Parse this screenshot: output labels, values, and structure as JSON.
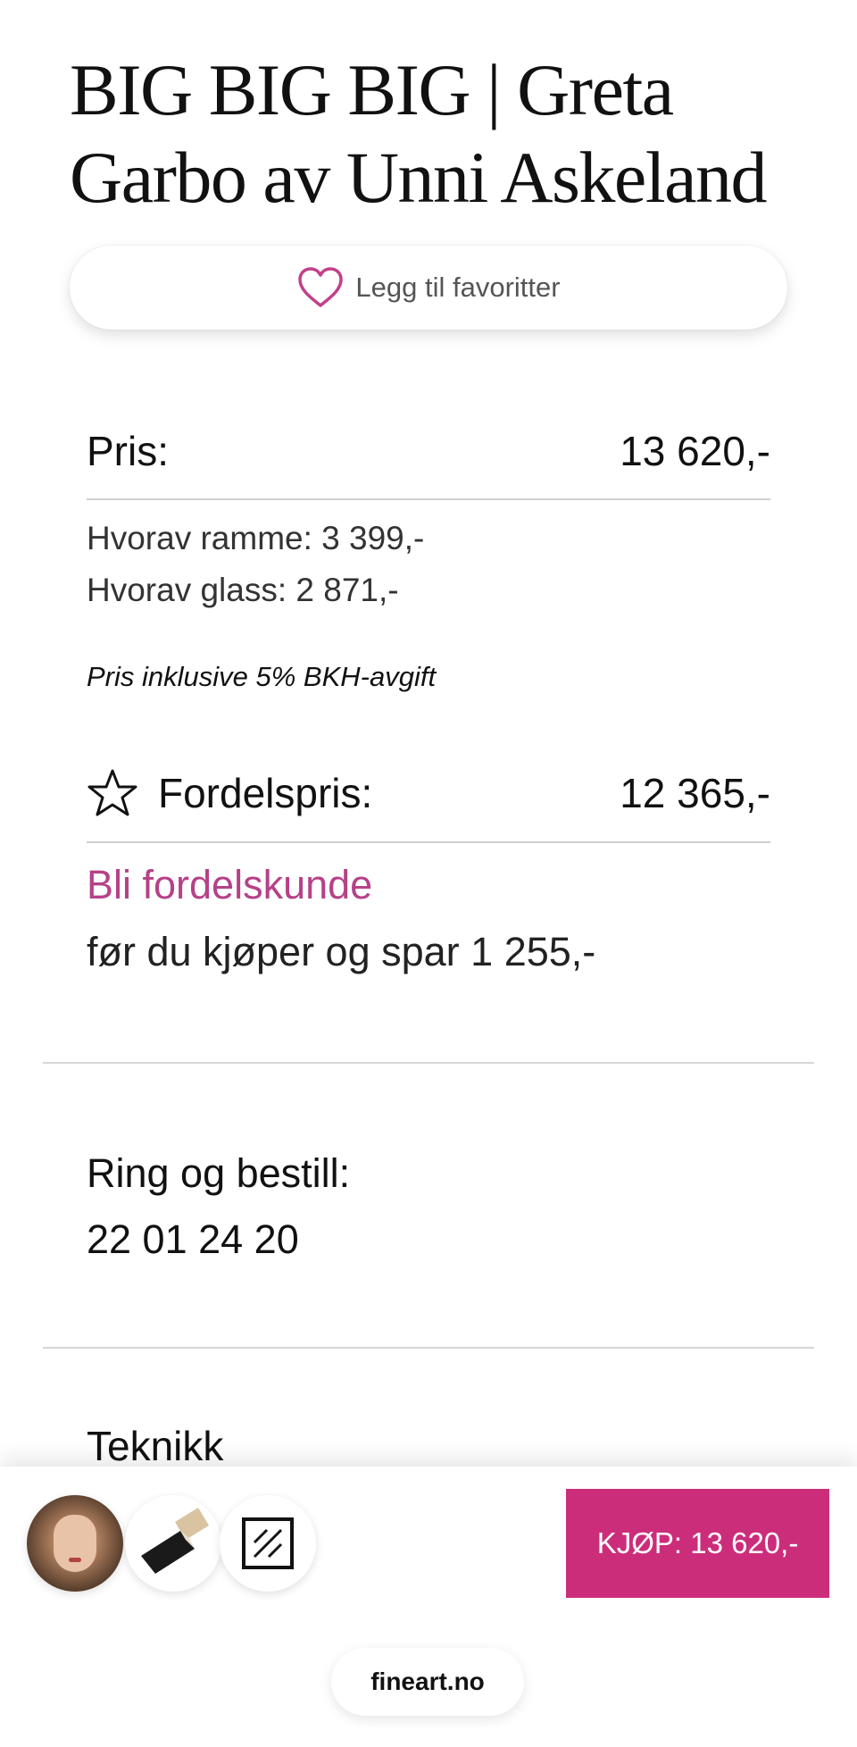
{
  "product": {
    "title": "BIG BIG BIG | Greta Garbo av Unni Askeland"
  },
  "favorite": {
    "label": "Legg til favoritter",
    "icon": "heart-icon"
  },
  "pricing": {
    "price_label": "Pris:",
    "price_value": "13 620,-",
    "frame_line": "Hvorav ramme: 3 399,-",
    "glass_line": "Hvorav glass: 2 871,-",
    "vat_note": "Pris inklusive 5% BKH-avgift",
    "member_label": "Fordelspris:",
    "member_value": "12 365,-",
    "member_icon": "star-icon",
    "member_link": "Bli fordelskunde",
    "member_text": "før du kjøper og spar 1 255,-"
  },
  "contact": {
    "label": "Ring og bestill:",
    "phone": "22 01 24 20"
  },
  "sections": {
    "technique_title": "Teknikk"
  },
  "bottom_bar": {
    "thumbnails": [
      "artwork-thumbnail",
      "frame-thumbnail",
      "glass-thumbnail"
    ],
    "buy_label": "KJØP: 13 620,-"
  },
  "browser": {
    "url": "fineart.no"
  },
  "colors": {
    "accent": "#cc2d7b",
    "link": "#b64188",
    "divider": "#cfcfcf"
  }
}
